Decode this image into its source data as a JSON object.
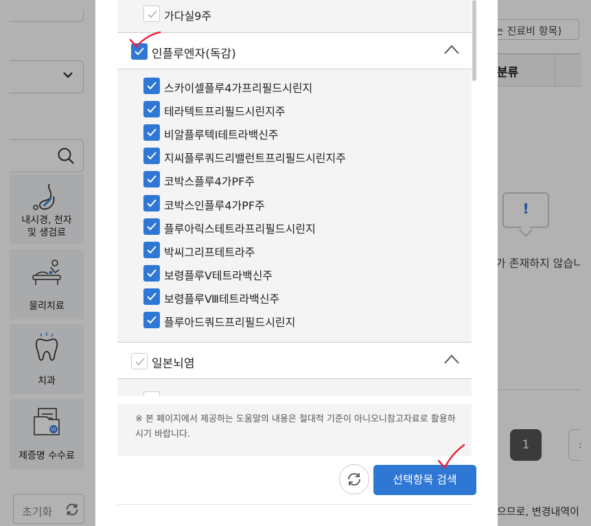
{
  "background": {
    "left_panel": {
      "categories": [
        {
          "label_lines": [
            "내시경, 천자",
            "및 생검료"
          ],
          "icon": "endoscopy-icon"
        },
        {
          "label_lines": [
            "물리치료"
          ],
          "icon": "physical-therapy-icon"
        },
        {
          "label_lines": [
            "치과"
          ],
          "icon": "tooth-icon"
        },
        {
          "label_lines": [
            "제증명 수수료"
          ],
          "icon": "certificate-fee-icon"
        }
      ],
      "reset_label": "초기화"
    },
    "right_panel": {
      "header_fragment": "는 진료비 항목)",
      "column_header": "분류",
      "empty_message": "가 존재하지 않습니",
      "current_page": "1",
      "footer_fragment": "으므로, 변경내역이"
    }
  },
  "modal": {
    "top_item": {
      "label": "가다실9주",
      "checked": true
    },
    "groups": [
      {
        "label": "인플루엔자(독감)",
        "checked": true,
        "expanded": true,
        "items": [
          "스카이셀플루4가프리필드시린지",
          "테라텍트프리필드시린지주",
          "비알플루텍I테트라백신주",
          "지씨플루쿼드리밸런트프리필드시린지주",
          "코박스플루4가PF주",
          "코박스인플루4가PF주",
          "플루아릭스테트라프리필드시린지",
          "박씨그리프테트라주",
          "보령플루Ⅴ테트라백신주",
          "보령플루Ⅷ테트라백신주",
          "플루아드쿼드프리필드시린지"
        ]
      },
      {
        "label": "일본뇌염",
        "checked": false,
        "expanded": true,
        "items": []
      }
    ],
    "notice": "※ 본 페이지에서 제공하는 도움말의 내용은 절대적 기준이 아니오니참고자료로 활용하시기 바랍니다.",
    "search_button_label": "선택항목 검색",
    "colors": {
      "accent": "#2f77d4",
      "annotation": "#e8223a"
    }
  }
}
